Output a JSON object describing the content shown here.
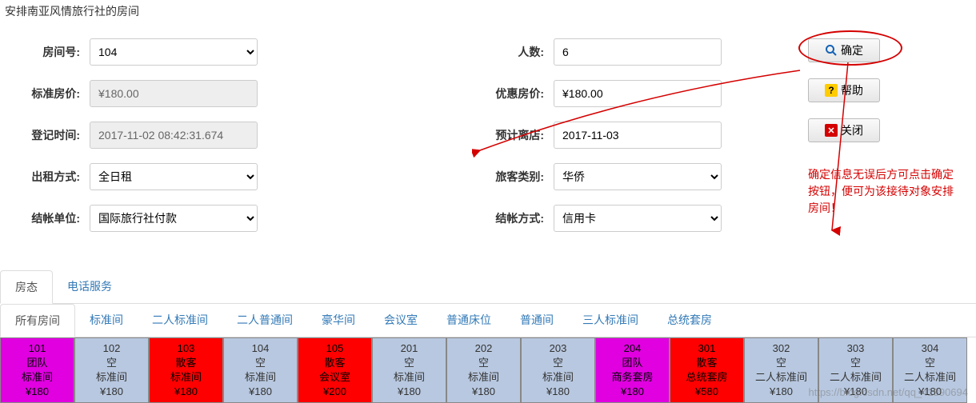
{
  "page_title": "安排南亚风情旅行社的房间",
  "form": {
    "room_no": {
      "label": "房间号:",
      "value": "104"
    },
    "people": {
      "label": "人数:",
      "value": "6"
    },
    "std_price": {
      "label": "标准房价:",
      "value": "¥180.00"
    },
    "disc_price": {
      "label": "优惠房价:",
      "value": "¥180.00"
    },
    "checkin_time": {
      "label": "登记时间:",
      "value": "2017-11-02 08:42:31.674"
    },
    "checkout_date": {
      "label": "预计离店:",
      "value": "2017-11-03"
    },
    "rent_mode": {
      "label": "出租方式:",
      "value": "全日租"
    },
    "guest_type": {
      "label": "旅客类别:",
      "value": "华侨"
    },
    "bill_unit": {
      "label": "结帐单位:",
      "value": "国际旅行社付款"
    },
    "bill_mode": {
      "label": "结帐方式:",
      "value": "信用卡"
    }
  },
  "buttons": {
    "confirm": "确定",
    "help": "帮助",
    "close": "关闭"
  },
  "annotation": "确定信息无误后方可点击确定按钮，便可为该接待对象安排房间！",
  "tabs": {
    "items": [
      "房态",
      "电话服务"
    ],
    "active": 0
  },
  "room_type_tabs": {
    "items": [
      "所有房间",
      "标准间",
      "二人标准间",
      "二人普通间",
      "豪华间",
      "会议室",
      "普通床位",
      "普通间",
      "三人标准间",
      "总统套房"
    ],
    "active": 0
  },
  "rooms": [
    {
      "no": "101",
      "status": "团队",
      "type": "标准间",
      "price": "¥180",
      "color": "magenta"
    },
    {
      "no": "102",
      "status": "空",
      "type": "标准间",
      "price": "¥180",
      "color": "gray"
    },
    {
      "no": "103",
      "status": "散客",
      "type": "标准间",
      "price": "¥180",
      "color": "red"
    },
    {
      "no": "104",
      "status": "空",
      "type": "标准间",
      "price": "¥180",
      "color": "gray"
    },
    {
      "no": "105",
      "status": "散客",
      "type": "会议室",
      "price": "¥200",
      "color": "red"
    },
    {
      "no": "201",
      "status": "空",
      "type": "标准间",
      "price": "¥180",
      "color": "gray"
    },
    {
      "no": "202",
      "status": "空",
      "type": "标准间",
      "price": "¥180",
      "color": "gray"
    },
    {
      "no": "203",
      "status": "空",
      "type": "标准间",
      "price": "¥180",
      "color": "gray"
    },
    {
      "no": "204",
      "status": "团队",
      "type": "商务套房",
      "price": "¥180",
      "color": "magenta"
    },
    {
      "no": "301",
      "status": "散客",
      "type": "总统套房",
      "price": "¥580",
      "color": "red"
    },
    {
      "no": "302",
      "status": "空",
      "type": "二人标准间",
      "price": "¥180",
      "color": "gray"
    },
    {
      "no": "303",
      "status": "空",
      "type": "二人标准间",
      "price": "¥180",
      "color": "gray"
    },
    {
      "no": "304",
      "status": "空",
      "type": "二人标准间",
      "price": "¥180",
      "color": "gray"
    }
  ],
  "watermark": "https://blog.csdn.net/qq_41890694"
}
